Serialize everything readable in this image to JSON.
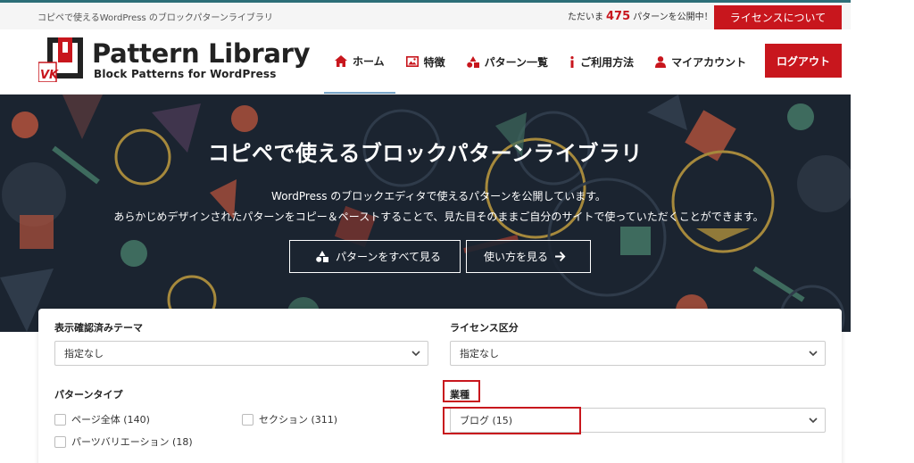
{
  "topbar": {
    "tagline": "コピペで使えるWordPress のブロックパターンライブラリ",
    "count_prefix": "ただいま",
    "count_value": "475",
    "count_suffix": "パターンを公開中！",
    "license_label": "ライセンスについて"
  },
  "header": {
    "logo_title": "Pattern Library",
    "logo_subtitle": "Block Patterns for WordPress",
    "logo_badge": "VK",
    "nav": [
      {
        "label": "ホーム",
        "icon": "home-icon"
      },
      {
        "label": "特徴",
        "icon": "image-icon"
      },
      {
        "label": "パターン一覧",
        "icon": "shapes-icon"
      },
      {
        "label": "ご利用方法",
        "icon": "info-icon"
      },
      {
        "label": "マイアカウント",
        "icon": "user-icon"
      }
    ],
    "logout_label": "ログアウト"
  },
  "hero": {
    "title": "コピペで使えるブロックパターンライブラリ",
    "desc_line1": "WordPress のブロックエディタで使えるパターンを公開しています。",
    "desc_line2": "あらかじめデザインされたパターンをコピー＆ペーストすることで、見た目そのままご自分のサイトで使っていただくことができます。",
    "btn_all": "パターンをすべて見る",
    "btn_how": "使い方を見る"
  },
  "filters": {
    "theme_label": "表示確認済みテーマ",
    "theme_value": "指定なし",
    "license_label": "ライセンス区分",
    "license_value": "指定なし",
    "type_label": "パターンタイプ",
    "type_options": [
      "ページ全体 (140)",
      "セクション (311)",
      "パーツバリエーション (18)"
    ],
    "industry_label": "業種",
    "industry_value": "ブログ (15)"
  },
  "colors": {
    "accent": "#c8161d",
    "hero_bg": "#1b2430",
    "topbar_border": "#2c6e78"
  }
}
